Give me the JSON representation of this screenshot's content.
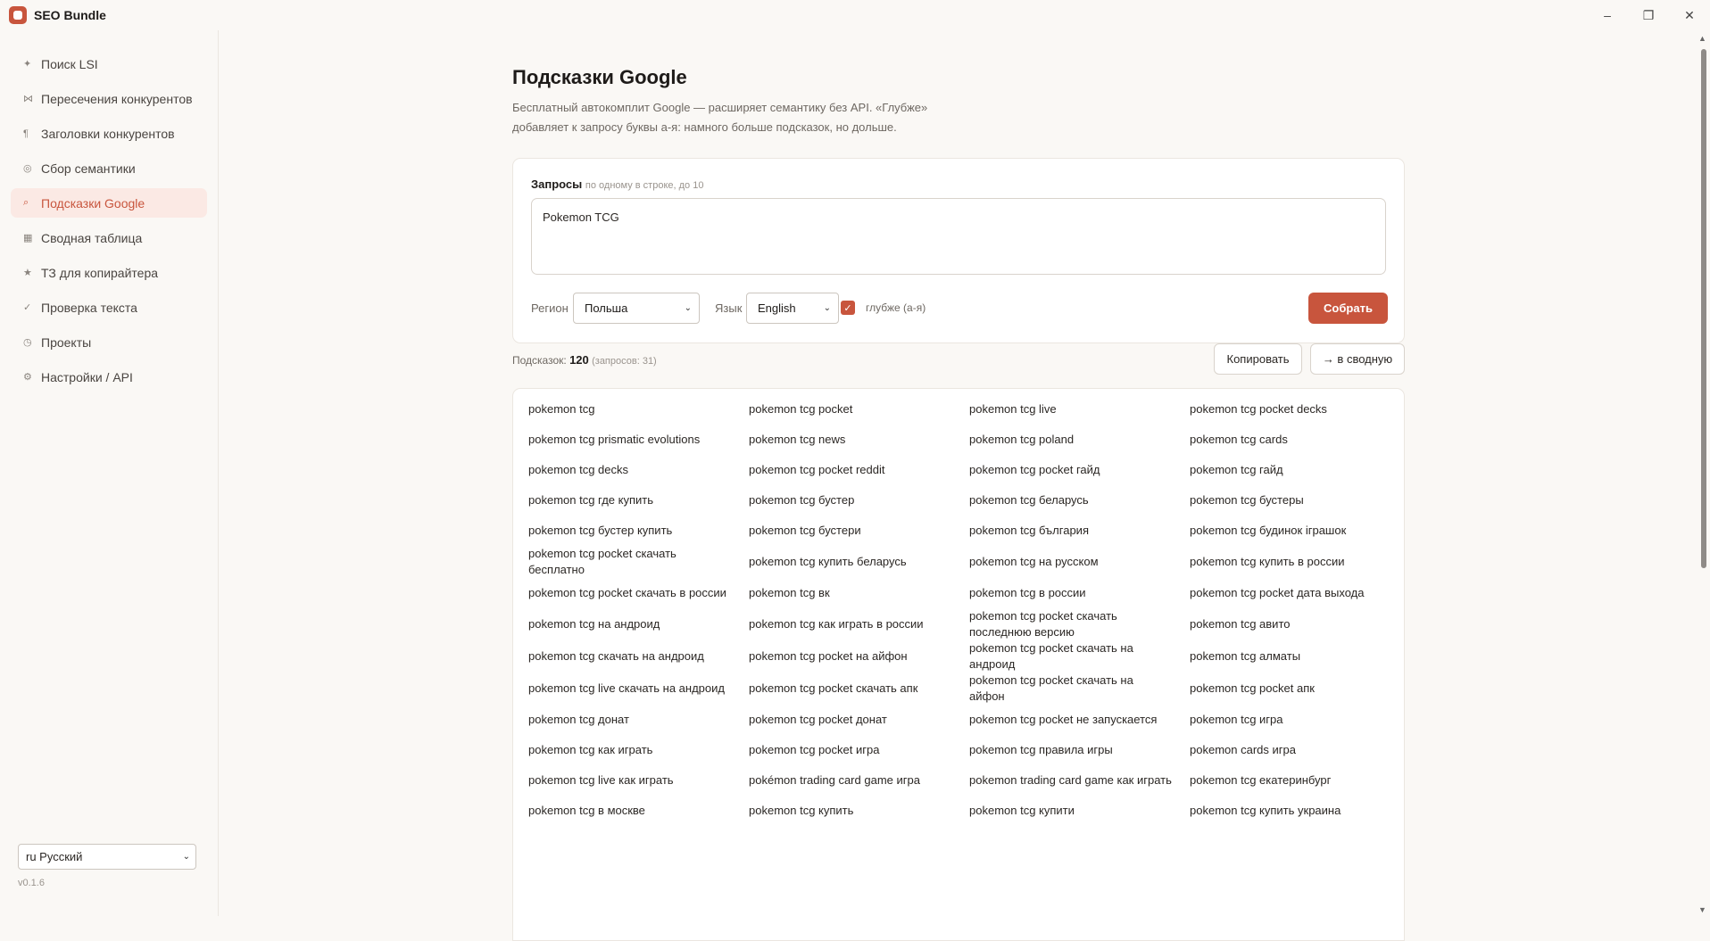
{
  "app": {
    "title": "SEO Bundle"
  },
  "window_controls": {
    "minimize": "–",
    "maximize": "❐",
    "close": "✕"
  },
  "sidebar": {
    "items": [
      {
        "icon": "sparkle-icon",
        "glyph": "✦",
        "label": "Поиск LSI",
        "active": false
      },
      {
        "icon": "intersection-icon",
        "glyph": "⋈",
        "label": "Пересечения конкурентов",
        "active": false
      },
      {
        "icon": "paragraph-icon",
        "glyph": "¶",
        "label": "Заголовки конкурентов",
        "active": false
      },
      {
        "icon": "target-icon",
        "glyph": "◎",
        "label": "Сбор семантики",
        "active": false
      },
      {
        "icon": "search-icon",
        "glyph": "⌕",
        "label": "Подсказки Google",
        "active": true
      },
      {
        "icon": "table-icon",
        "glyph": "▦",
        "label": "Сводная таблица",
        "active": false
      },
      {
        "icon": "star-icon",
        "glyph": "★",
        "label": "ТЗ для копирайтера",
        "active": false
      },
      {
        "icon": "check-icon",
        "glyph": "✓",
        "label": "Проверка текста",
        "active": false
      },
      {
        "icon": "clock-icon",
        "glyph": "◷",
        "label": "Проекты",
        "active": false
      },
      {
        "icon": "settings-icon",
        "glyph": "⚙",
        "label": "Настройки / API",
        "active": false
      }
    ],
    "language": "ru Русский",
    "version": "v0.1.6"
  },
  "page": {
    "title": "Подсказки Google",
    "description_line1": "Бесплатный автокомплит Google — расширяет семантику без API. «Глубже»",
    "description_line2": "добавляет к запросу буквы а-я: намного больше подсказок, но дольше."
  },
  "form": {
    "queries_label": "Запросы",
    "queries_hint": "по одному в строке, до 10",
    "queries_value": "Pokemon TCG",
    "region_label": "Регион",
    "region_value": "Польша",
    "language_label": "Язык",
    "language_value": "English",
    "deeper_checked": true,
    "deeper_label": "глубже (а-я)",
    "submit_label": "Собрать"
  },
  "summary": {
    "label": "Подсказок:",
    "count": "120",
    "queries_note": "(запросов: 31)",
    "copy_label": "Копировать",
    "to_summary_label": "→ в сводную"
  },
  "suggestions": [
    [
      "pokemon tcg",
      "pokemon tcg pocket",
      "pokemon tcg live",
      "pokemon tcg pocket decks"
    ],
    [
      "pokemon tcg prismatic evolutions",
      "pokemon tcg news",
      "pokemon tcg poland",
      "pokemon tcg cards"
    ],
    [
      "pokemon tcg decks",
      "pokemon tcg pocket reddit",
      "pokemon tcg pocket гайд",
      "pokemon tcg гайд"
    ],
    [
      "pokemon tcg где купить",
      "pokemon tcg бустер",
      "pokemon tcg беларусь",
      "pokemon tcg бустеры"
    ],
    [
      "pokemon tcg бустер купить",
      "pokemon tcg бустери",
      "pokemon tcg българия",
      "pokemon tcg будинок іграшок"
    ],
    [
      "pokemon tcg pocket скачать бесплатно",
      "pokemon tcg купить беларусь",
      "pokemon tcg на русском",
      "pokemon tcg купить в россии"
    ],
    [
      "pokemon tcg pocket скачать в россии",
      "pokemon tcg вк",
      "pokemon tcg в россии",
      "pokemon tcg pocket дата выхода"
    ],
    [
      "pokemon tcg на андроид",
      "pokemon tcg как играть в россии",
      "pokemon tcg pocket скачать последнюю версию",
      "pokemon tcg авито"
    ],
    [
      "pokemon tcg скачать на андроид",
      "pokemon tcg pocket на айфон",
      "pokemon tcg pocket скачать на андроид",
      "pokemon tcg алматы"
    ],
    [
      "pokemon tcg live скачать на андроид",
      "pokemon tcg pocket скачать апк",
      "pokemon tcg pocket скачать на айфон",
      "pokemon tcg pocket апк"
    ],
    [
      "pokemon tcg донат",
      "pokemon tcg pocket донат",
      "pokemon tcg pocket не запускается",
      "pokemon tcg игра"
    ],
    [
      "pokemon tcg как играть",
      "pokemon tcg pocket игра",
      "pokemon tcg правила игры",
      "pokemon cards игра"
    ],
    [
      "pokemon tcg live как играть",
      "pokémon trading card game игра",
      "pokemon trading card game как играть",
      "pokemon tcg екатеринбург"
    ],
    [
      "pokemon tcg в москве",
      "pokemon tcg купить",
      "pokemon tcg купити",
      "pokemon tcg купить украина"
    ]
  ]
}
